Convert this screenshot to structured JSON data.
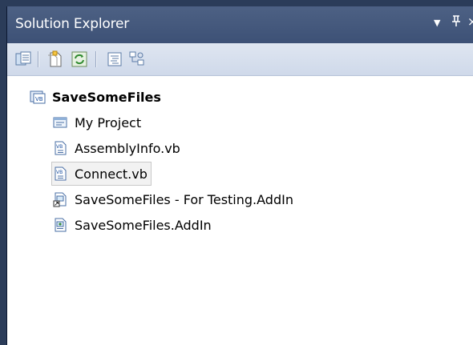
{
  "panel": {
    "title": "Solution Explorer",
    "dropdown_glyph": "▼",
    "pin_glyph": "ф",
    "close_glyph": "×",
    "toolbar": {
      "buttons": [
        {
          "icon": "properties-icon"
        },
        {
          "icon": "show-all-files-icon"
        },
        {
          "icon": "refresh-icon"
        },
        {
          "icon": "view-code-icon"
        },
        {
          "icon": "class-diagram-icon"
        }
      ]
    }
  },
  "tree": {
    "root": {
      "label": "SaveSomeFiles",
      "icon": "vb-project-icon"
    },
    "items": [
      {
        "label": "My Project",
        "icon": "my-project-icon"
      },
      {
        "label": "AssemblyInfo.vb",
        "icon": "vb-file-icon"
      },
      {
        "label": "Connect.vb",
        "icon": "vb-file-icon",
        "selected": true
      },
      {
        "label": "SaveSomeFiles - For Testing.AddIn",
        "icon": "addin-shortcut-icon"
      },
      {
        "label": "SaveSomeFiles.AddIn",
        "icon": "addin-file-icon"
      }
    ]
  },
  "colors": {
    "title_bar": "#3d5176",
    "toolbar": "#d6dfee",
    "background": "#2b3c59"
  }
}
